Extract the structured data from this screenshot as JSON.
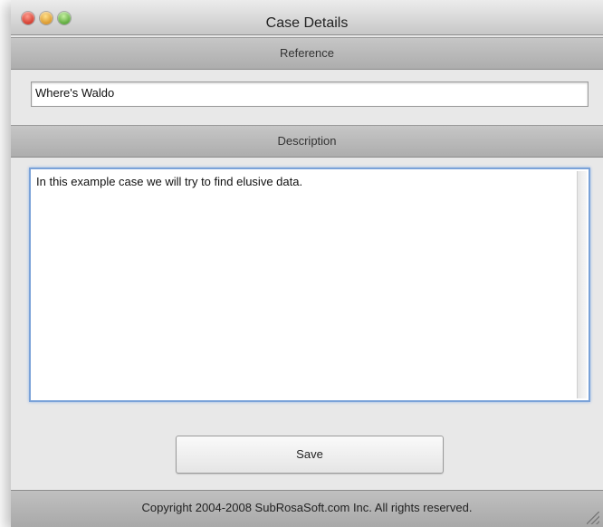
{
  "window": {
    "title": "Case Details"
  },
  "reference": {
    "header": "Reference",
    "value": "Where's Waldo"
  },
  "description": {
    "header": "Description",
    "value": "In this example case we will try to find elusive data."
  },
  "actions": {
    "save_label": "Save"
  },
  "footer": {
    "copyright": "Copyright 2004-2008 SubRosaSoft.com Inc. All rights reserved."
  },
  "colors": {
    "focus_ring": "#7aa2d8",
    "close": "#d23a2c",
    "minimize": "#d9962a",
    "zoom": "#5aa83a"
  }
}
